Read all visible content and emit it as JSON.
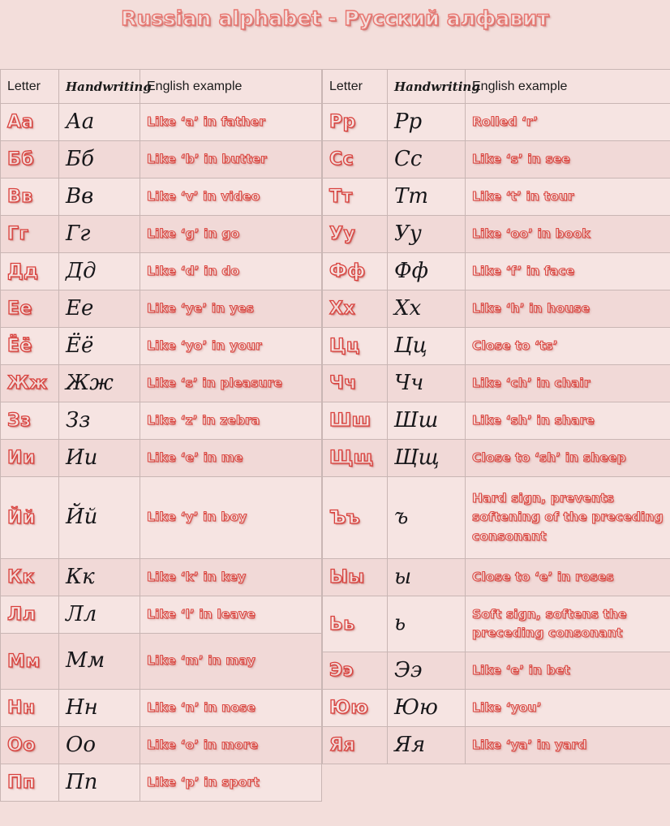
{
  "title": "Russian alphabet - Русский алфавит",
  "colors": {
    "page_background": "#f3dedb",
    "cell_background": "#f6e4e2",
    "band_background": "#f1d9d7",
    "border": "#c9b6b4",
    "accent_red": "#d9403c",
    "header_text": "#1b1b1b",
    "handwriting_text": "#17171a"
  },
  "headers": {
    "letter": "Letter",
    "handwriting": "Handwriting",
    "english_example": "English example"
  },
  "left_table": [
    {
      "letter": "Аа",
      "handwriting": "Аа",
      "english_example": "Like ‘a’ in father",
      "tall": false
    },
    {
      "letter": "Бб",
      "handwriting": "Бб",
      "english_example": "Like ‘b’ in butter",
      "tall": false
    },
    {
      "letter": "Вв",
      "handwriting": "Вв",
      "english_example": "Like ‘v’ in video",
      "tall": false
    },
    {
      "letter": "Гг",
      "handwriting": "Гг",
      "english_example": "Like ‘g’ in go",
      "tall": false
    },
    {
      "letter": "Дд",
      "handwriting": "Дд",
      "english_example": "Like ‘d’ in do",
      "tall": false
    },
    {
      "letter": "Ее",
      "handwriting": "Ее",
      "english_example": "Like ‘ye’ in yes",
      "tall": false
    },
    {
      "letter": "Ёё",
      "handwriting": "Ёё",
      "english_example": "Like ‘yo’ in your",
      "tall": false
    },
    {
      "letter": "Жж",
      "handwriting": "Жж",
      "english_example": "Like ‘s’ in pleasure",
      "tall": false
    },
    {
      "letter": "Зз",
      "handwriting": "Зз",
      "english_example": "Like ‘z’ in zebra",
      "tall": false
    },
    {
      "letter": "Ии",
      "handwriting": "Ии",
      "english_example": "Like ‘e’ in me",
      "tall": false
    },
    {
      "letter": "Йй",
      "handwriting": "Йй",
      "english_example": "Like ‘y’ in boy",
      "tall": "xtall"
    },
    {
      "letter": "Кк",
      "handwriting": "Кк",
      "english_example": "Like ‘k’ in key",
      "tall": false
    },
    {
      "letter": "Лл",
      "handwriting": "Лл",
      "english_example": "Like ‘l’ in leave",
      "tall": false
    },
    {
      "letter": "Мм",
      "handwriting": "Мм",
      "english_example": "Like ‘m’ in may",
      "tall": true
    },
    {
      "letter": "Нн",
      "handwriting": "Нн",
      "english_example": "Like ‘n’ in nose",
      "tall": false
    },
    {
      "letter": "Оо",
      "handwriting": "Оо",
      "english_example": "Like ‘o’ in more",
      "tall": false
    },
    {
      "letter": "Пп",
      "handwriting": "Пп",
      "english_example": "Like ‘p’ in sport",
      "tall": false
    }
  ],
  "right_table": [
    {
      "letter": "Рр",
      "handwriting": "Рр",
      "english_example": "Rolled ‘r’",
      "tall": false
    },
    {
      "letter": "Сс",
      "handwriting": "Сс",
      "english_example": "Like ‘s’ in see",
      "tall": false
    },
    {
      "letter": "Тт",
      "handwriting": "Тт",
      "english_example": "Like ‘t’ in tour",
      "tall": false
    },
    {
      "letter": "Уу",
      "handwriting": "Уу",
      "english_example": "Like ‘oo’ in book",
      "tall": false
    },
    {
      "letter": "Фф",
      "handwriting": "Фф",
      "english_example": "Like ‘f’ in face",
      "tall": false
    },
    {
      "letter": "Хх",
      "handwriting": "Хх",
      "english_example": "Like ‘h’ in house",
      "tall": false
    },
    {
      "letter": "Цц",
      "handwriting": "Цц",
      "english_example": "Close to ‘ts’",
      "tall": false
    },
    {
      "letter": "Чч",
      "handwriting": "Чч",
      "english_example": "Like ‘ch’ in chair",
      "tall": false
    },
    {
      "letter": "Шш",
      "handwriting": "Шш",
      "english_example": "Like ‘sh’ in share",
      "tall": false
    },
    {
      "letter": "Щщ",
      "handwriting": "Щщ",
      "english_example": "Close to ‘sh’ in sheep",
      "tall": false
    },
    {
      "letter": "Ъъ",
      "handwriting": "ъ",
      "english_example": "Hard sign, prevents softening of the preceding consonant",
      "tall": "xtall"
    },
    {
      "letter": "Ыы",
      "handwriting": "ы",
      "english_example": "Close to ‘e’ in roses",
      "tall": false
    },
    {
      "letter": "Ьь",
      "handwriting": "ь",
      "english_example": "Soft sign, softens the preceding consonant",
      "tall": true
    },
    {
      "letter": "Ээ",
      "handwriting": "Ээ",
      "english_example": "Like ‘e’ in bet",
      "tall": false
    },
    {
      "letter": "Юю",
      "handwriting": "Юю",
      "english_example": "Like ‘you’",
      "tall": false
    },
    {
      "letter": "Яя",
      "handwriting": "Яя",
      "english_example": "Like ‘ya’ in yard",
      "tall": false
    }
  ]
}
